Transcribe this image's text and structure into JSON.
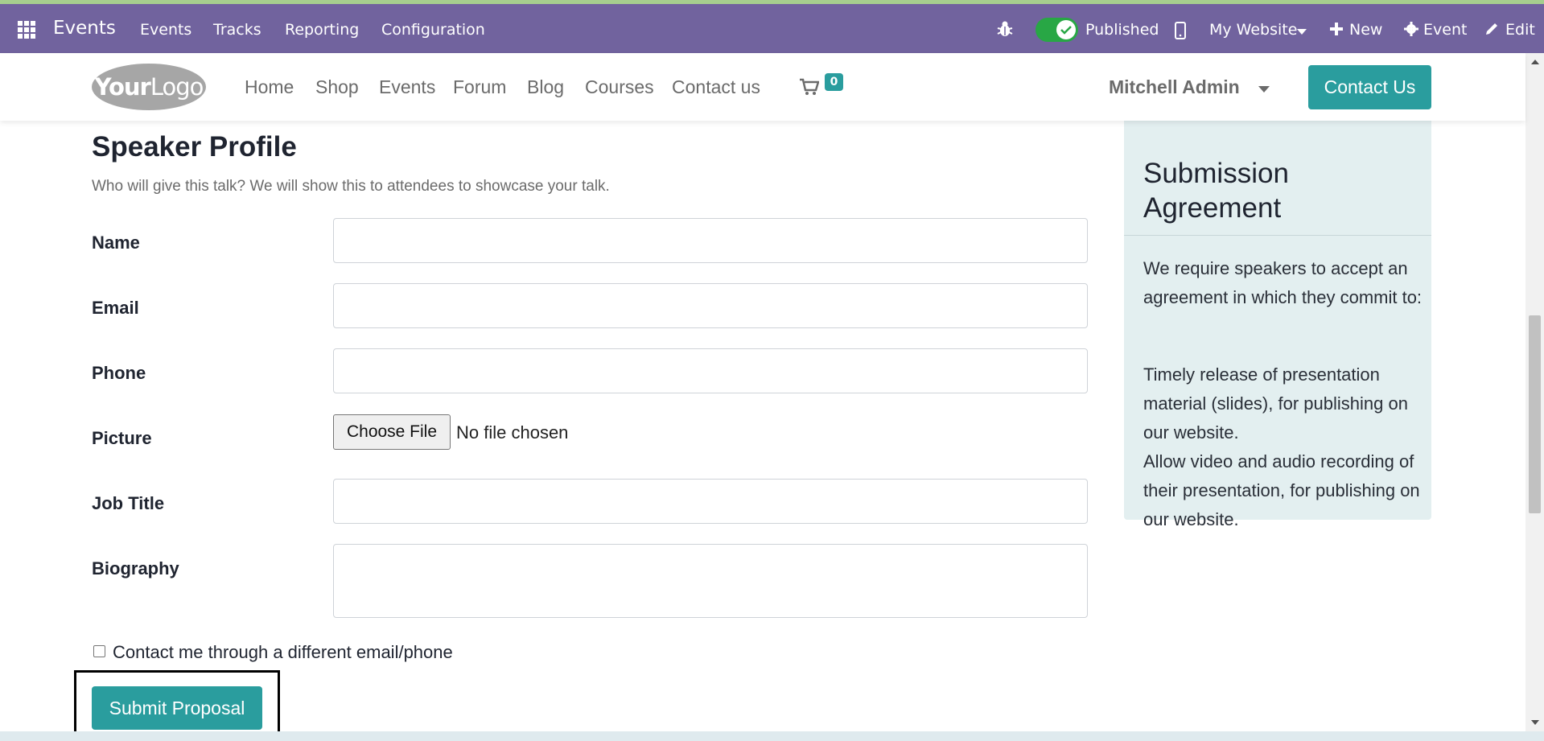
{
  "admin_bar": {
    "app_name": "Events",
    "menu": [
      "Events",
      "Tracks",
      "Reporting",
      "Configuration"
    ],
    "published_label": "Published",
    "website_label": "My Website",
    "new_label": "New",
    "event_label": "Event",
    "edit_label": "Edit",
    "colors": {
      "bar": "#71639e",
      "toggle_on": "#28a745"
    }
  },
  "site_nav": {
    "logo_text_bold": "Your",
    "logo_text_regular": "Logo",
    "links": [
      "Home",
      "Shop",
      "Events",
      "Forum",
      "Blog",
      "Courses",
      "Contact us"
    ],
    "cart_count": "0",
    "user_name": "Mitchell Admin",
    "contact_button": "Contact Us",
    "accent_color": "#2a9d9e"
  },
  "form": {
    "title": "Speaker Profile",
    "subtitle": "Who will give this talk? We will show this to attendees to showcase your talk.",
    "fields": {
      "name_label": "Name",
      "name_value": "",
      "email_label": "Email",
      "email_value": "",
      "phone_label": "Phone",
      "phone_value": "",
      "picture_label": "Picture",
      "file_button": "Choose File",
      "file_status": "No file chosen",
      "job_title_label": "Job Title",
      "job_title_value": "",
      "biography_label": "Biography",
      "biography_value": ""
    },
    "contact_checkbox_label": "Contact me through a different email/phone",
    "contact_checkbox_checked": false,
    "submit_label": "Submit Proposal"
  },
  "aside": {
    "title": "Submission Agreement",
    "intro": "We require speakers to accept an agreement in which they commit to:",
    "point1": "Timely release of presentation material (slides), for publishing on our website.",
    "point2": "Allow video and audio recording of their presentation, for publishing on our website.",
    "background": "#e3eff0"
  }
}
